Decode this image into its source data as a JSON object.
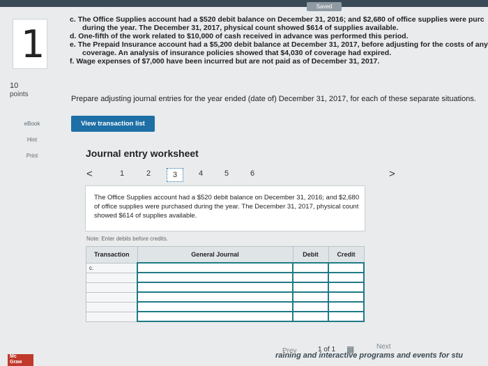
{
  "header": {
    "saved_label": "Saved"
  },
  "question": {
    "number": "1",
    "points_value": "10",
    "points_label": "points"
  },
  "sidebar": {
    "ebook": "eBook",
    "hint": "Hint",
    "print": "Print"
  },
  "problem_lines": [
    {
      "label": "c.",
      "text": "The Office Supplies account had a $520 debit balance on December 31, 2016; and $2,680 of office supplies were purc",
      "indent": false
    },
    {
      "label": "",
      "text": "during the year. The December 31, 2017, physical count showed $614 of supplies available.",
      "indent": true
    },
    {
      "label": "d.",
      "text": "One-fifth of the work related to $10,000 of cash received in advance was performed this period.",
      "indent": false
    },
    {
      "label": "e.",
      "text": "The Prepaid Insurance account had a $5,200 debit balance at December 31, 2017, before adjusting for the costs of any",
      "indent": false
    },
    {
      "label": "",
      "text": "coverage. An analysis of insurance policies showed that $4,030 of coverage had expired.",
      "indent": true
    },
    {
      "label": "f.",
      "text": "Wage expenses of $7,000 have been incurred but are not paid as of December 31, 2017.",
      "indent": false
    }
  ],
  "prompt": "Prepare adjusting journal entries for the year ended (date of) December 31, 2017, for each of these separate situations.",
  "view_button": "View transaction list",
  "worksheet": {
    "title": "Journal entry worksheet",
    "prev_arrow": "<",
    "next_arrow": ">",
    "pages": [
      "1",
      "2",
      "3",
      "4",
      "5",
      "6"
    ],
    "active_page": "3",
    "description": "The Office Supplies account had a $520 debit balance on December 31, 2016; and $2,680 of office supplies were purchased during the year. The December 31, 2017, physical count showed $614 of supplies available.",
    "note": "Note: Enter debits before credits.",
    "columns": {
      "transaction": "Transaction",
      "general_journal": "General Journal",
      "debit": "Debit",
      "credit": "Credit"
    },
    "rows": [
      {
        "transaction": "c.",
        "account": "",
        "debit": "",
        "credit": ""
      },
      {
        "transaction": "",
        "account": "",
        "debit": "",
        "credit": ""
      },
      {
        "transaction": "",
        "account": "",
        "debit": "",
        "credit": ""
      },
      {
        "transaction": "",
        "account": "",
        "debit": "",
        "credit": ""
      },
      {
        "transaction": "",
        "account": "",
        "debit": "",
        "credit": ""
      },
      {
        "transaction": "",
        "account": "",
        "debit": "",
        "credit": ""
      }
    ]
  },
  "footer": {
    "prev": "Prev",
    "page_indicator": "1 of 1",
    "next": "Next",
    "grid_icon": "grid-icon"
  },
  "branding": {
    "logo_line1": "Mc",
    "logo_line2": "Graw",
    "marketing": "raining and interactive programs and events for stu"
  },
  "colors": {
    "accent": "#1d6fa5",
    "grid_border": "#1f7a86",
    "logo": "#c0392b"
  }
}
